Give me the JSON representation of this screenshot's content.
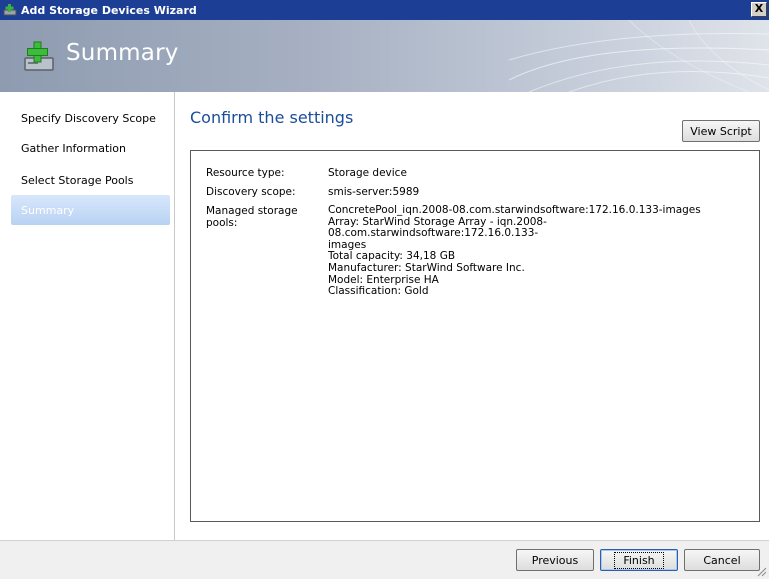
{
  "window": {
    "title": "Add Storage Devices Wizard",
    "close_label": "X"
  },
  "banner": {
    "heading": "Summary"
  },
  "nav": {
    "items": [
      {
        "label": "Specify Discovery Scope",
        "active": false
      },
      {
        "label": "Gather Information",
        "active": false
      },
      {
        "label": "Select Storage Pools",
        "active": false
      },
      {
        "label": "Summary",
        "active": true
      }
    ]
  },
  "main": {
    "title": "Confirm the settings",
    "view_script_label": "View Script",
    "summary": {
      "resource_type_key": "Resource type:",
      "resource_type_value": "Storage device",
      "discovery_scope_key": "Discovery scope:",
      "discovery_scope_value": "smis-server:5989",
      "pools_key": "Managed storage pools:",
      "pools_lines": [
        "ConcretePool_iqn.2008-08.com.starwindsoftware:172.16.0.133-images",
        "Array: StarWind Storage Array - iqn.2008-08.com.starwindsoftware:172.16.0.133-",
        "images",
        "Total capacity: 34,18 GB",
        "Manufacturer: StarWind Software Inc.",
        "Model: Enterprise HA",
        "Classification: Gold"
      ]
    }
  },
  "footer": {
    "previous_label": "Previous",
    "finish_label": "Finish",
    "cancel_label": "Cancel"
  },
  "colors": {
    "title_blue": "#1b4d9b",
    "titlebar": "#1c3f95",
    "nav_active": "#c6dbf6"
  }
}
